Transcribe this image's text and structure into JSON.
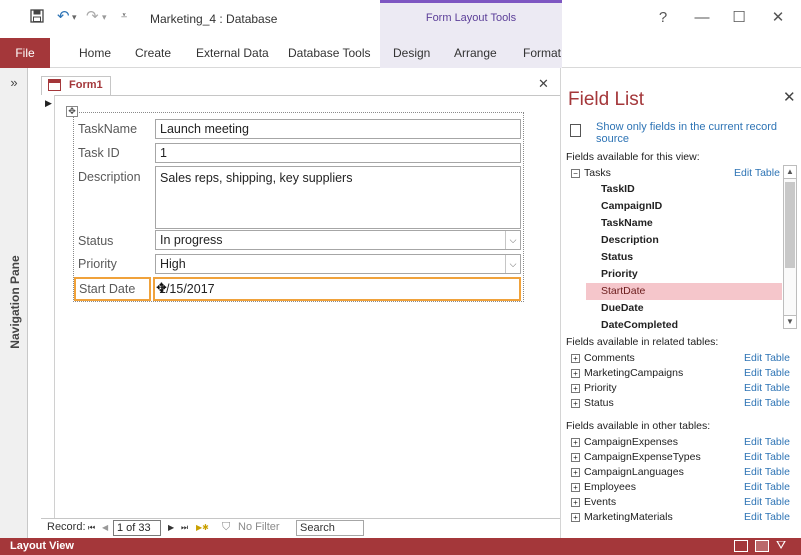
{
  "window": {
    "doc_title": "Marketing_4 : Database",
    "context_group": "Form Layout Tools",
    "help": "?",
    "minimize": "—",
    "maximize": "☐",
    "close": "✕",
    "save_icon": "save-icon",
    "undo_icon": "undo-icon",
    "redo_icon": "redo-icon"
  },
  "ribbon": {
    "file": "File",
    "tabs": [
      "Home",
      "Create",
      "External Data",
      "Database Tools"
    ],
    "context_tabs": [
      "Design",
      "Arrange",
      "Format"
    ]
  },
  "nav": {
    "toggle": "»",
    "label": "Navigation Pane"
  },
  "form": {
    "tab_label": "Form1",
    "close": "✕",
    "fields": [
      {
        "label": "TaskName",
        "value": "Launch meeting"
      },
      {
        "label": "Task ID",
        "value": "1"
      },
      {
        "label": "Description",
        "value": "Sales reps, shipping, key suppliers"
      },
      {
        "label": "Status",
        "value": "In progress"
      },
      {
        "label": "Priority",
        "value": "High"
      },
      {
        "label": "Start Date",
        "value": "1/15/2017"
      }
    ]
  },
  "recordbar": {
    "record": "Record:",
    "first": "⏮",
    "prev": "◀",
    "current": "1 of 33",
    "next": "▶",
    "last": "⏭",
    "new": "▶✱",
    "no_filter": "No Filter",
    "search": "Search"
  },
  "fieldlist": {
    "title": "Field List",
    "close": "✕",
    "show_only": "Show only fields in the current record source",
    "available_header": "Fields available for this view:",
    "tasks_group": "Tasks",
    "edit_table": "Edit Table",
    "task_fields": [
      "TaskID",
      "CampaignID",
      "TaskName",
      "Description",
      "Status",
      "Priority",
      "StartDate",
      "DueDate",
      "DateCompleted"
    ],
    "highlighted_field": "StartDate",
    "related_header": "Fields available in related tables:",
    "related": [
      "Comments",
      "MarketingCampaigns",
      "Priority",
      "Status"
    ],
    "other_header": "Fields available in other tables:",
    "other": [
      "CampaignExpenses",
      "CampaignExpenseTypes",
      "CampaignLanguages",
      "Employees",
      "Events",
      "MarketingMaterials"
    ]
  },
  "status": {
    "mode": "Layout View"
  },
  "colors": {
    "accent": "#a4373a",
    "context": "#7e57c2",
    "highlight": "#f5c6cb",
    "selection": "#f0a23b"
  }
}
